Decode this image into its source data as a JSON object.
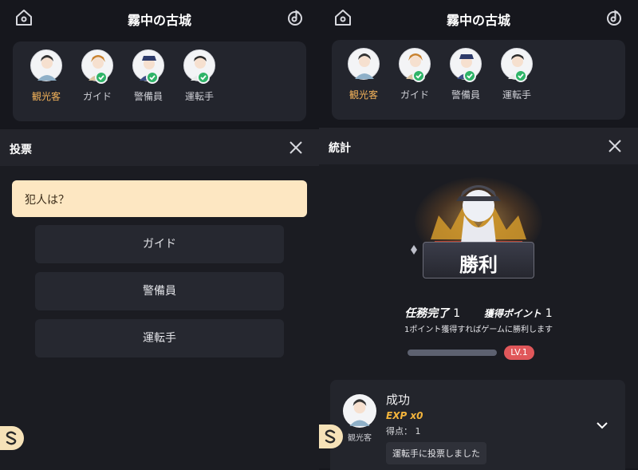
{
  "game": {
    "title": "霧中の古城"
  },
  "roles": [
    {
      "label": "観光客",
      "is_me": true,
      "voted": false,
      "icon": "character-avatar"
    },
    {
      "label": "ガイド",
      "is_me": false,
      "voted": true,
      "icon": "character-avatar"
    },
    {
      "label": "警備員",
      "is_me": false,
      "voted": true,
      "icon": "character-avatar"
    },
    {
      "label": "運転手",
      "is_me": false,
      "voted": true,
      "icon": "character-avatar"
    }
  ],
  "vote": {
    "title": "投票",
    "question": "犯人は？",
    "options": [
      "ガイド",
      "警備員",
      "運転手"
    ]
  },
  "stats": {
    "title": "統計",
    "result": "勝利",
    "mission_label": "任務完了",
    "mission_value": "1",
    "points_label": "獲得ポイント",
    "points_value": "1",
    "note": "1ポイント獲得すればゲームに勝利します",
    "level": "LV.1",
    "level_progress": 0.0
  },
  "player_result": {
    "role": "観光客",
    "status": "成功",
    "exp": "EXP x0",
    "score_label": "得点：",
    "score_value": "1",
    "vote_text": "運転手に投票しました"
  },
  "colors": {
    "accent": "#f4b35a",
    "question_bg": "#fde7c2",
    "check": "#2fb468",
    "level_badge": "#e0575a"
  }
}
